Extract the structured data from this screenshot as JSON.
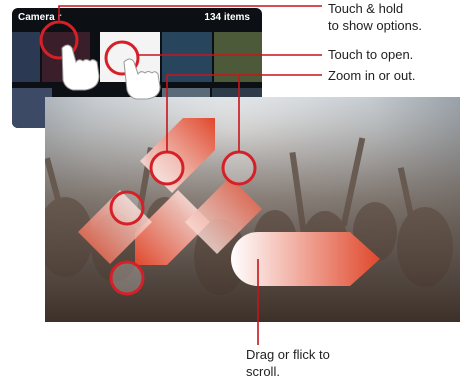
{
  "gallery": {
    "title": "Camera r",
    "count": "134 items"
  },
  "callouts": {
    "touch_hold": "Touch & hold",
    "touch_hold_2": "to show options.",
    "touch_open": "Touch to open.",
    "zoom": "Zoom in or out.",
    "drag": "Drag or flick to",
    "drag_2": "scroll."
  },
  "colors": {
    "accent_red": "#d62027",
    "line_red": "#c8141b"
  }
}
